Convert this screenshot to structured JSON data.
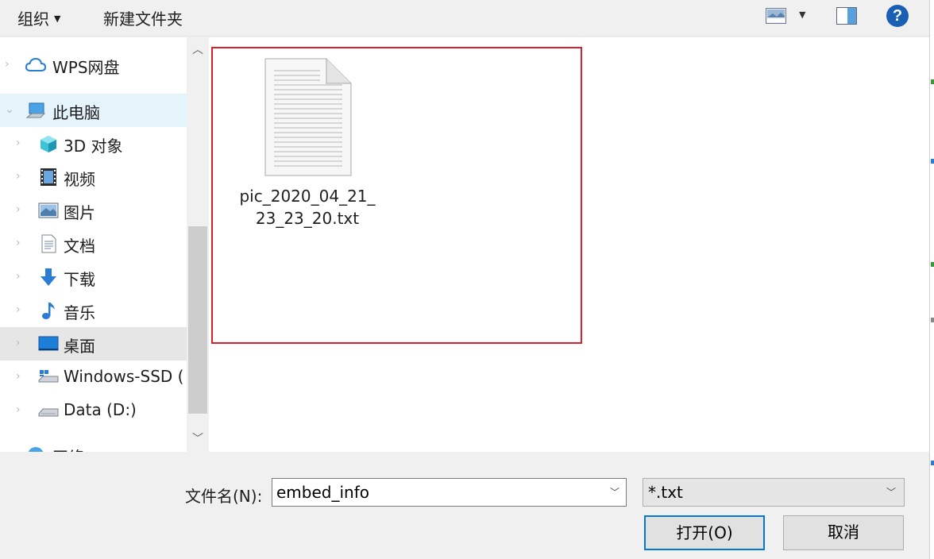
{
  "toolbar": {
    "organize_label": "组织",
    "new_folder_label": "新建文件夹"
  },
  "nav": {
    "items": [
      {
        "label": "WPS网盘",
        "icon": "cloud-icon"
      },
      {
        "label": "此电脑",
        "icon": "computer-icon"
      },
      {
        "label": "3D 对象",
        "icon": "3d-objects-icon"
      },
      {
        "label": "视频",
        "icon": "video-icon"
      },
      {
        "label": "图片",
        "icon": "pictures-icon"
      },
      {
        "label": "文档",
        "icon": "documents-icon"
      },
      {
        "label": "下载",
        "icon": "download-icon"
      },
      {
        "label": "音乐",
        "icon": "music-icon"
      },
      {
        "label": "桌面",
        "icon": "desktop-icon"
      },
      {
        "label": "Windows-SSD (",
        "icon": "drive-windows-icon"
      },
      {
        "label": "Data (D:)",
        "icon": "drive-icon"
      },
      {
        "label": "网络",
        "icon": "network-icon"
      }
    ]
  },
  "content": {
    "files": [
      {
        "name_line1": "pic_2020_04_21_",
        "name_line2": "23_23_20.txt",
        "icon": "text-file-icon"
      }
    ]
  },
  "bottom": {
    "filename_label": "文件名(N):",
    "filename_value": "embed_info",
    "filter_value": "*.txt",
    "open_label": "打开(O)",
    "cancel_label": "取消"
  },
  "colors": {
    "highlight_border": "#d9202e",
    "selected_row": "#e5f3fb",
    "hover_row": "#e6e6e6",
    "primary_button_border": "#0078d7",
    "help_icon": "#1a5fb4"
  }
}
